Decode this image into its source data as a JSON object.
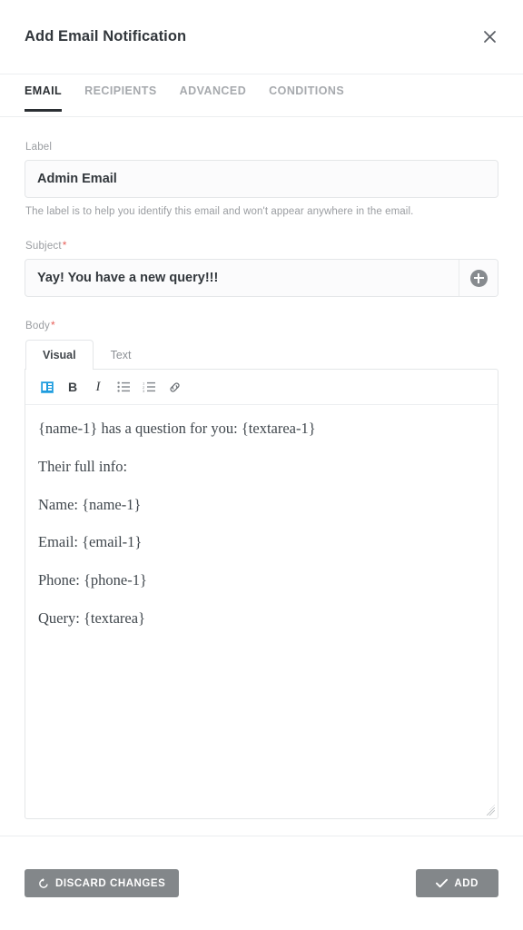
{
  "header": {
    "title": "Add Email Notification",
    "close_icon": "close-icon"
  },
  "tabs": [
    {
      "label": "EMAIL",
      "active": true
    },
    {
      "label": "RECIPIENTS",
      "active": false
    },
    {
      "label": "ADVANCED",
      "active": false
    },
    {
      "label": "CONDITIONS",
      "active": false
    }
  ],
  "form": {
    "label_field": {
      "label": "Label",
      "value": "Admin Email",
      "placeholder": "",
      "help": "The label is to help you identify this email and won't appear anywhere in the email."
    },
    "subject_field": {
      "label": "Subject",
      "required_marker": "*",
      "value": "Yay! You have a new query!!!",
      "placeholder": "",
      "addon_icon": "plus-circle-icon"
    },
    "body_field": {
      "label": "Body",
      "required_marker": "*",
      "editor_tabs": [
        {
          "label": "Visual",
          "active": true
        },
        {
          "label": "Text",
          "active": false
        }
      ],
      "toolbar": [
        {
          "name": "add-media-icon",
          "glyph": ""
        },
        {
          "name": "bold-icon",
          "glyph": "B"
        },
        {
          "name": "italic-icon",
          "glyph": "I"
        },
        {
          "name": "bulleted-list-icon",
          "glyph": ""
        },
        {
          "name": "numbered-list-icon",
          "glyph": ""
        },
        {
          "name": "link-icon",
          "glyph": ""
        }
      ],
      "content": [
        "{name-1} has a question for you: {textarea-1}",
        "Their full info:",
        "Name: {name-1}",
        "Email: {email-1}",
        "Phone: {phone-1}",
        "Query: {textarea}"
      ]
    }
  },
  "footer": {
    "discard_label": "DISCARD CHANGES",
    "discard_icon": "undo-icon",
    "add_label": "ADD",
    "add_icon": "check-icon"
  },
  "colors": {
    "accent_required": "#e8605a",
    "button_gray": "#83878a",
    "media_icon_blue": "#1f9bdd",
    "text_dark": "#32373c",
    "text_muted": "#9a9da1"
  }
}
